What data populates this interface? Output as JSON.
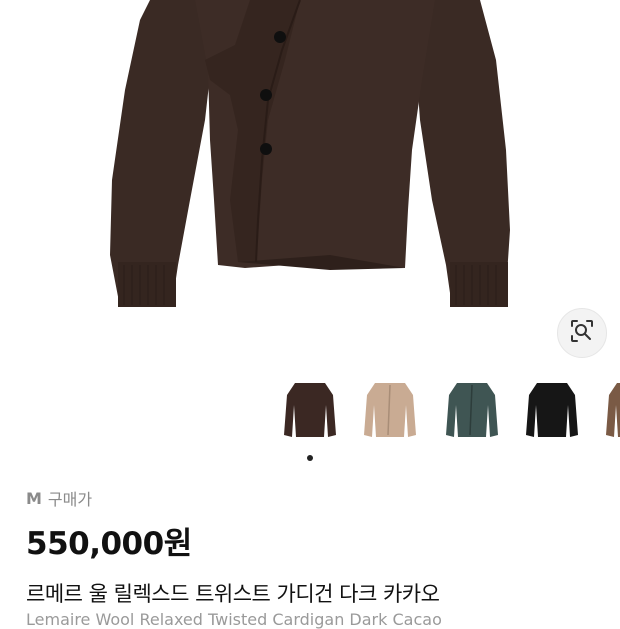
{
  "product": {
    "size": "M",
    "purchase_label": "구매가",
    "price": "550,000원",
    "title_ko": "르메르 울 릴렉스드 트위스트 가디건 다크 카카오",
    "title_en": "Lemaire Wool Relaxed Twisted Cardigan Dark Cacao"
  },
  "gallery": {
    "thumbnails": [
      {
        "name": "dark-cacao",
        "color": "#3b2823"
      },
      {
        "name": "beige",
        "color": "#c9ab93"
      },
      {
        "name": "teal-gray",
        "color": "#3f5553"
      },
      {
        "name": "black",
        "color": "#161616"
      },
      {
        "name": "brown",
        "color": "#7a5a45"
      }
    ],
    "active_index": 0,
    "lens_icon": "image-search-icon"
  }
}
